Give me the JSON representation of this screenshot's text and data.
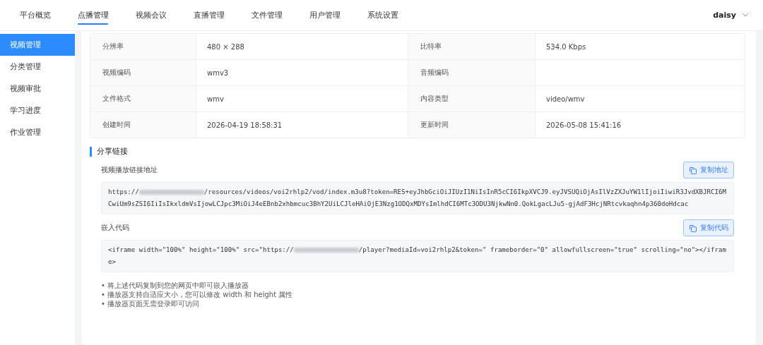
{
  "nav": {
    "items": [
      {
        "label": "平台概览",
        "selected": false
      },
      {
        "label": "点播管理",
        "selected": true
      },
      {
        "label": "视频会议",
        "selected": false
      },
      {
        "label": "直播管理",
        "selected": false
      },
      {
        "label": "文件管理",
        "selected": false
      },
      {
        "label": "用户管理",
        "selected": false
      },
      {
        "label": "系统设置",
        "selected": false
      }
    ],
    "user": "daisy"
  },
  "sidebar": {
    "items": [
      {
        "label": "视频管理",
        "selected": true
      },
      {
        "label": "分类管理",
        "selected": false
      },
      {
        "label": "视频审批",
        "selected": false
      },
      {
        "label": "学习进度",
        "selected": false
      },
      {
        "label": "作业管理",
        "selected": false
      }
    ]
  },
  "info_table": {
    "rows": [
      [
        {
          "label": "分辨率",
          "value": "480 × 288"
        },
        {
          "label": "比特率",
          "value": "534.0 Kbps"
        }
      ],
      [
        {
          "label": "视频编码",
          "value": "wmv3"
        },
        {
          "label": "音频编码"
        }
      ],
      [
        {
          "label": "文件格式",
          "value": "wmv"
        },
        {
          "label": "内容类型",
          "value": "video/wmv"
        }
      ],
      [
        {
          "label": "创建时间",
          "value": "2026-04-19 18:58:31"
        },
        {
          "label": "更新时间",
          "value": "2026-05-08 15:41:16"
        }
      ]
    ]
  },
  "share": {
    "title": "分享链接",
    "blocks": [
      {
        "label": "视频播放链接地址",
        "button": "复制地址",
        "code_before": "https://",
        "code_after": "/resources/videos/voi2rhlp2/vod/index.m3u8?token=RES+eyJhbGciOiJIUzI1NiIsInR5cCI6IkpXVCJ9.eyJVSUQiOjAsIlVzZXJuYW1lIjoiIiwiR3JvdXBJRCI6MCwiUm9sZSI6IiIsIkxldmVsIjowLCJpc3MiOiJ4eEBnb2xhbmcuc3BhY2UiLCJleHAiOjE3Nzg1ODQxMDYsImlhdCI6MTc3ODU3NjkwNn0.QokLgacLJu5-gjAdF3HcjNRtcvkaqhn4p360doHdcac"
      },
      {
        "label": "嵌入代码",
        "button": "复制代码",
        "code_before": "<iframe width=\"100%\" height=\"100%\" src=\"https://",
        "code_after": "/player?mediaId=voi2rhlp2&token=\" frameborder=\"0\" allowfullscreen=\"true\" scrolling=\"no\"></iframe>"
      }
    ],
    "notes": [
      "• 将上述代码复制到您的网页中即可嵌入播放器",
      "• 播放器支持自适应大小，您可以修改 width 和 height 属性",
      "• 播放器页面无需登录即可访问"
    ]
  }
}
